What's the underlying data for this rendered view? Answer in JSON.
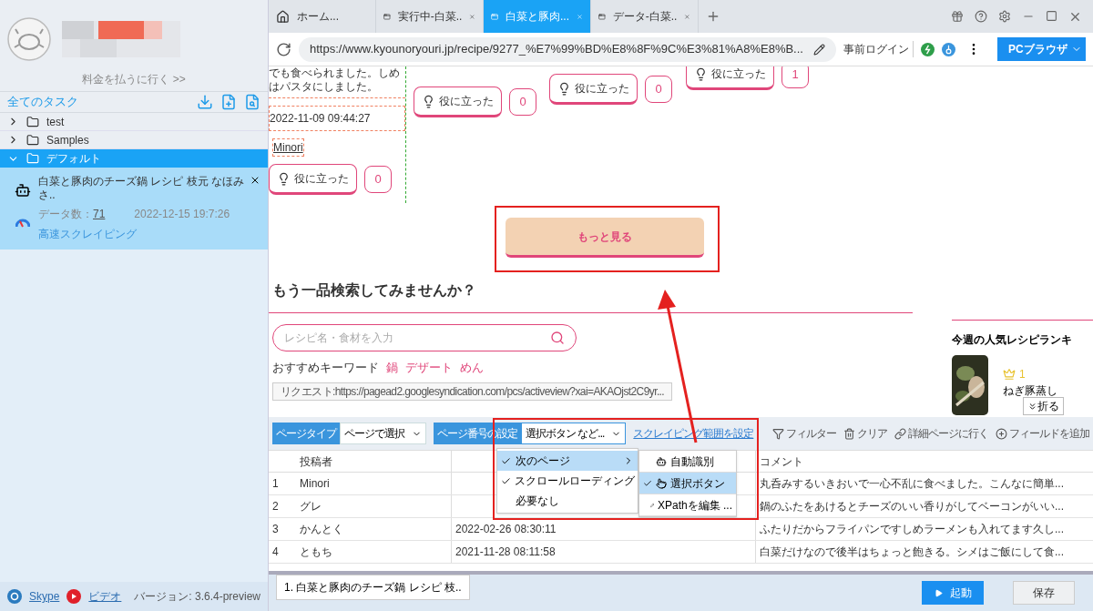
{
  "sidebar": {
    "payment_link": "料金を払うに行く >>",
    "section_title": "全てのタスク",
    "folders": [
      {
        "label": "test",
        "expanded": false,
        "selected": false
      },
      {
        "label": "Samples",
        "expanded": false,
        "selected": false
      },
      {
        "label": "デフォルト",
        "expanded": true,
        "selected": true,
        "tasks": [
          {
            "title": "白菜と豚肉のチーズ鍋 レシピ 枝元 なほみさ..",
            "data_label": "データ数：",
            "data_count": "71",
            "date": "2022-12-15 19:7:26",
            "mode": "高速スクレイピング"
          }
        ]
      }
    ],
    "footer": {
      "skype": "Skype",
      "video": "ビデオ",
      "version": "バージョン: 3.6.4-preview"
    }
  },
  "tabs": [
    {
      "label": "ホーム...",
      "selected": false,
      "kind": "home"
    },
    {
      "label": "実行中-白菜..",
      "selected": false,
      "kind": "page"
    },
    {
      "label": "白菜と豚肉...",
      "selected": true,
      "kind": "page"
    },
    {
      "label": "データ-白菜..",
      "selected": false,
      "kind": "page"
    }
  ],
  "address_bar": {
    "url": "https://www.kyounoryouri.jp/recipe/9277_%E7%99%BD%E8%8F%9C%E3%81%A8%E8%B...",
    "pre_login": "事前ログイン",
    "browser_mode": "PCブラウザ"
  },
  "page": {
    "comment_text": "でも食べられました。しめはパスタにしました。",
    "comment_date": "2022-11-09 09:44:27",
    "comment_author": "Minori",
    "helpful": [
      {
        "label": "役に立った",
        "count": "0"
      },
      {
        "label": "役に立った",
        "count": "0"
      },
      {
        "label": "役に立った",
        "count": "0"
      },
      {
        "label": "役に立った",
        "count": "1"
      }
    ],
    "more_button": "もっと見る",
    "search_heading": "もう一品検索してみませんか？",
    "search_placeholder": "レシピ名・食材を入力",
    "keywords_label": "おすすめキーワード",
    "keywords": [
      "鍋",
      "デザート",
      "めん"
    ],
    "ranking_title": "今週の人気レシピランキ",
    "rank": "1",
    "dish": "ねぎ豚蒸し",
    "collapse": "折る",
    "status_url": "リクエスト:https://pagead2.googlesyndication.com/pcs/activeview?xai=AKAOjst2C9yr..."
  },
  "toolbar": {
    "page_type_label": "ページタイプ",
    "page_type_value": "ページで選択",
    "page_number_label": "ページ番号の設定",
    "page_number_value": "選択ボタン など...",
    "range_link": "スクレイピング範囲を設定",
    "actions": [
      {
        "label": "フィルター",
        "kind": "filter"
      },
      {
        "label": "クリア",
        "kind": "trash"
      },
      {
        "label": "詳細ページに行く",
        "kind": "link"
      },
      {
        "label": "フィールドを追加",
        "kind": "add"
      }
    ]
  },
  "menu": [
    {
      "label": "次のページ",
      "checked": true,
      "selected": true,
      "submenu": true
    },
    {
      "label": "スクロールローディング",
      "checked": true,
      "selected": false,
      "submenu": false
    },
    {
      "label": "必要なし",
      "checked": false,
      "selected": false,
      "submenu": false
    }
  ],
  "submenu": [
    {
      "label": "自動識別",
      "checked": false,
      "selected": false,
      "kind": "robot"
    },
    {
      "label": "選択ボタン",
      "checked": true,
      "selected": true,
      "kind": "hand"
    },
    {
      "label": "XPathを編集 ...",
      "checked": false,
      "selected": false,
      "kind": "pencil"
    }
  ],
  "table": {
    "columns": [
      "投稿者",
      "コメント"
    ],
    "rows": [
      {
        "num": "1",
        "author": "Minori",
        "comment": "丸呑みするいきおいで一心不乱に食べました。こんなに簡単..."
      },
      {
        "num": "2",
        "author": "グレ",
        "comment": "鍋のふたをあけるとチーズのいい香りがしてベーコンがいい..."
      },
      {
        "num": "3",
        "author": "かんとく",
        "date": "2022-02-26 08:30:11",
        "comment": "ふたりだからフライパンですしめラーメンも入れてます久し..."
      },
      {
        "num": "4",
        "author": "ともち",
        "date": "2021-11-28 08:11:58",
        "comment": "白菜だけなので後半はちょっと飽きる。シメはご飯にして食..."
      }
    ]
  },
  "bottom": {
    "task_tab": "1. 白菜と豚肉のチーズ鍋 レシピ 枝..",
    "start": "起動",
    "save": "保存"
  }
}
